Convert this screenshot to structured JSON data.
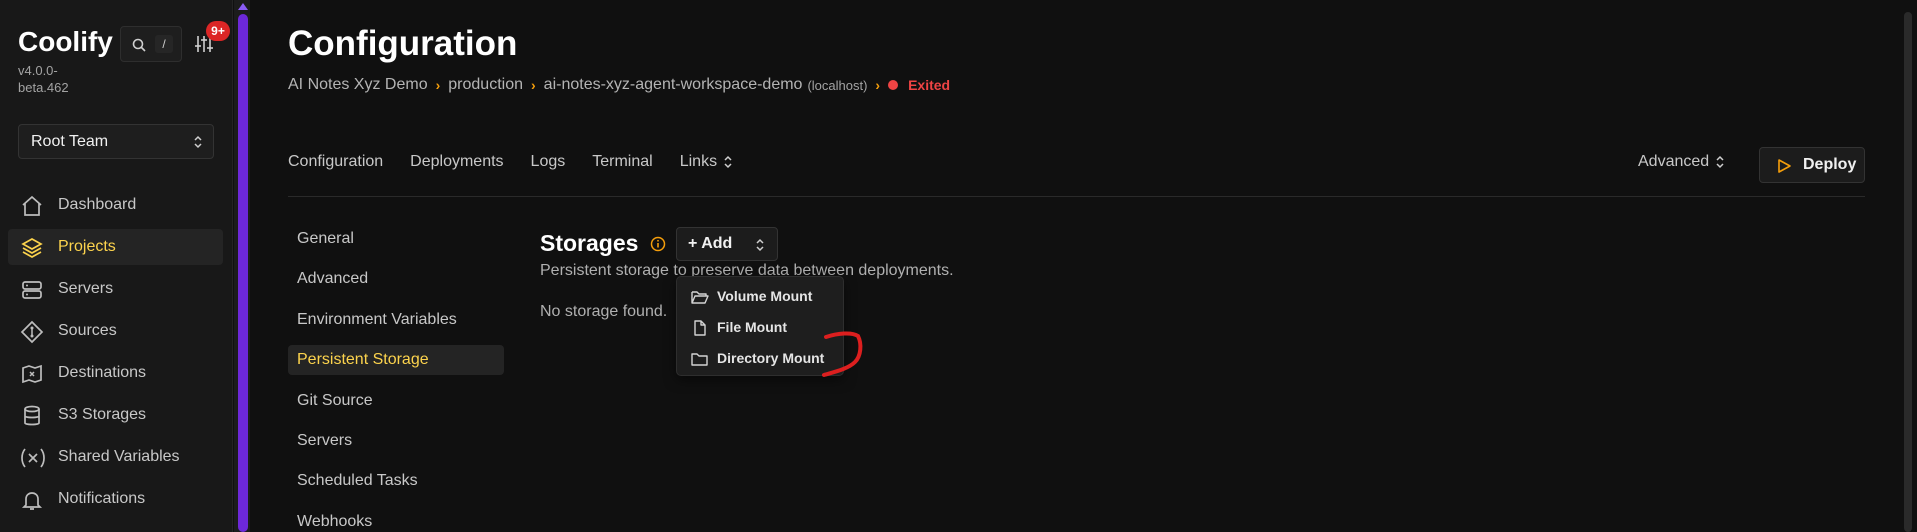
{
  "sidebar": {
    "brand": "Coolify",
    "version": "v4.0.0-beta.462",
    "search_shortcut": "/",
    "notification_badge": "9+",
    "team": "Root Team",
    "nav": [
      {
        "label": "Dashboard",
        "icon": "home-icon"
      },
      {
        "label": "Projects",
        "icon": "layers-icon",
        "active": true
      },
      {
        "label": "Servers",
        "icon": "server-icon"
      },
      {
        "label": "Sources",
        "icon": "git-icon"
      },
      {
        "label": "Destinations",
        "icon": "destination-icon"
      },
      {
        "label": "S3 Storages",
        "icon": "database-icon"
      },
      {
        "label": "Shared Variables",
        "icon": "variable-icon"
      },
      {
        "label": "Notifications",
        "icon": "bell-icon"
      }
    ]
  },
  "header": {
    "title": "Configuration",
    "breadcrumb": {
      "project": "AI Notes Xyz Demo",
      "environment": "production",
      "resource": "ai-notes-xyz-agent-workspace-demo",
      "host": "(localhost)",
      "status": "Exited"
    }
  },
  "tabs": [
    "Configuration",
    "Deployments",
    "Logs",
    "Terminal",
    "Links"
  ],
  "advanced_label": "Advanced",
  "deploy_label": "Deploy",
  "subnav": [
    "General",
    "Advanced",
    "Environment Variables",
    "Persistent Storage",
    "Git Source",
    "Servers",
    "Scheduled Tasks",
    "Webhooks"
  ],
  "subnav_active_index": 3,
  "storages": {
    "title": "Storages",
    "add_label": "+ Add",
    "description": "Persistent storage to preserve data between deployments.",
    "empty": "No storage found.",
    "dropdown": [
      "Volume Mount",
      "File Mount",
      "Directory Mount"
    ]
  },
  "colors": {
    "accent": "#fcd34d",
    "status": "#ef4444",
    "scrollbar": "#6d28d9"
  }
}
